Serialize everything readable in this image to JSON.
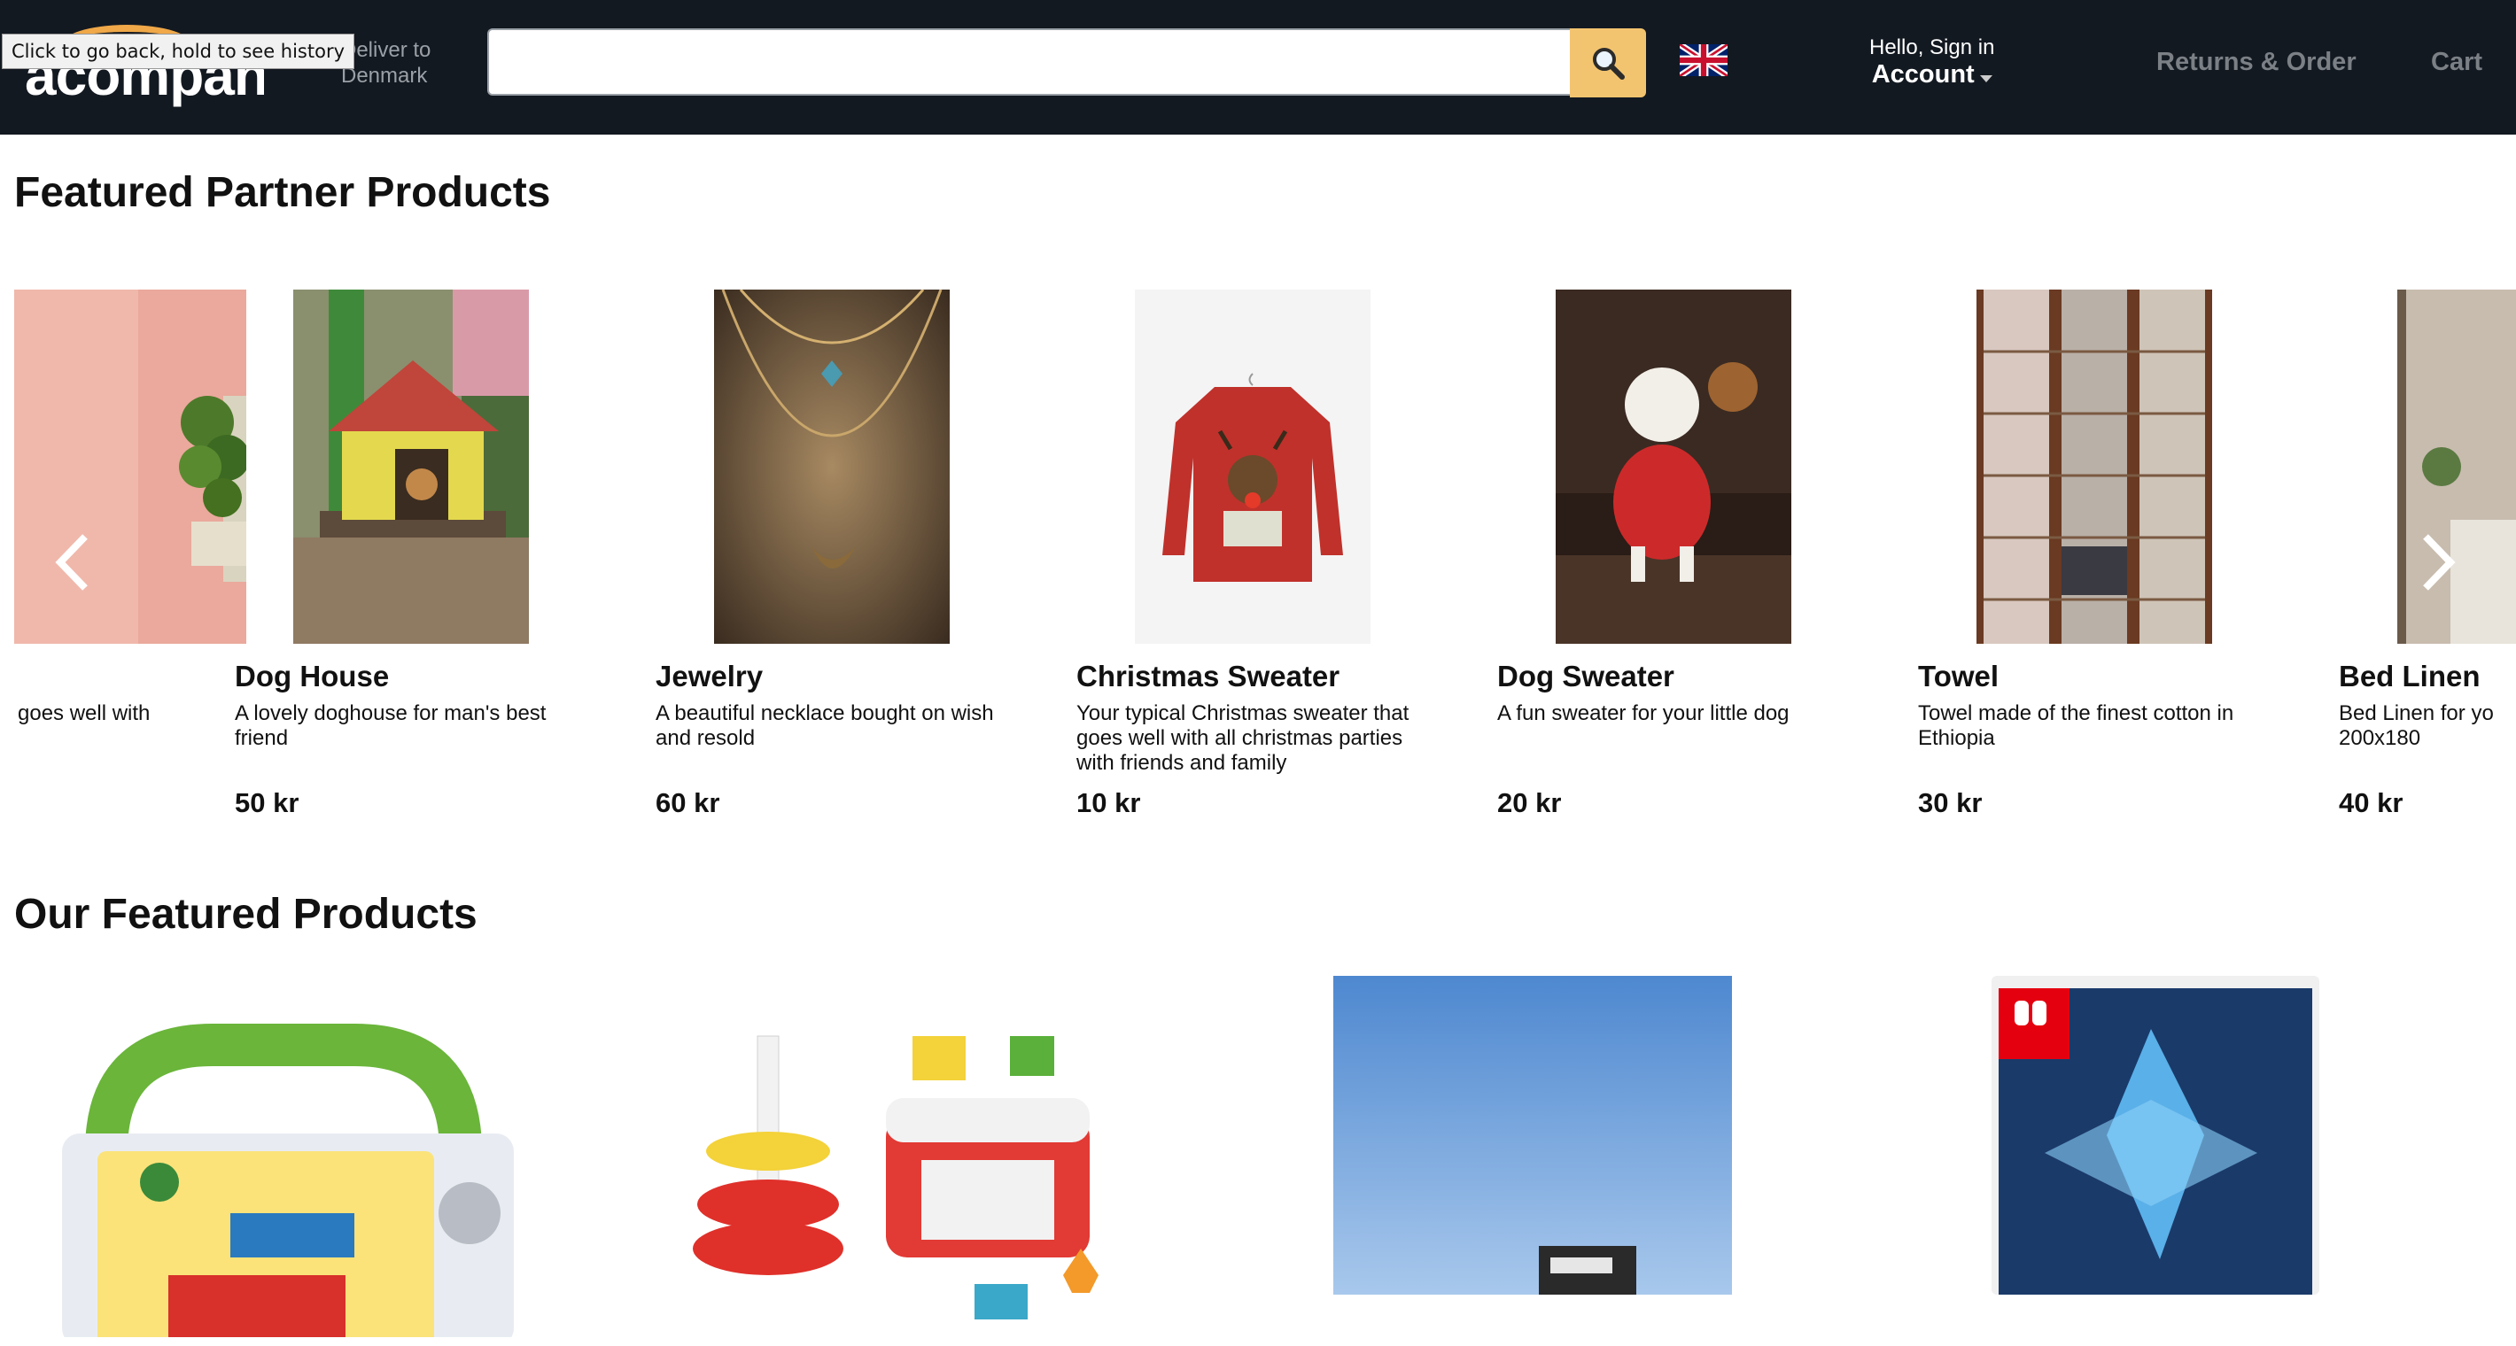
{
  "header": {
    "logo_text": "acompany",
    "deliver_line1": "Deliver to",
    "deliver_line2": "Denmark",
    "tooltip": "Click to go back, hold to see history",
    "search": {
      "value": "",
      "placeholder": ""
    },
    "account_hello": "Hello, Sign in",
    "account_label": "Account",
    "returns_label": "Returns & Order",
    "cart_label": "Cart"
  },
  "partner_section": {
    "title": "Featured Partner Products",
    "products": [
      {
        "name": "",
        "description": "goes well with",
        "price": ""
      },
      {
        "name": "Dog House",
        "description": "A lovely doghouse for man's best friend",
        "price": "50 kr"
      },
      {
        "name": "Jewelry",
        "description": "A beautiful necklace bought on wish and resold",
        "price": "60 kr"
      },
      {
        "name": "Christmas Sweater",
        "description": "Your typical Christmas sweater that goes well with all christmas parties with friends and family",
        "price": "10 kr"
      },
      {
        "name": "Dog Sweater",
        "description": "A fun sweater for your little dog",
        "price": "20 kr"
      },
      {
        "name": "Towel",
        "description": "Towel made of the finest cotton in Ethiopia",
        "price": "30 kr"
      },
      {
        "name": "Bed Linen",
        "description": "Bed Linen for yo 200x180",
        "price": "40 kr"
      }
    ]
  },
  "our_section": {
    "title": "Our Featured Products"
  }
}
